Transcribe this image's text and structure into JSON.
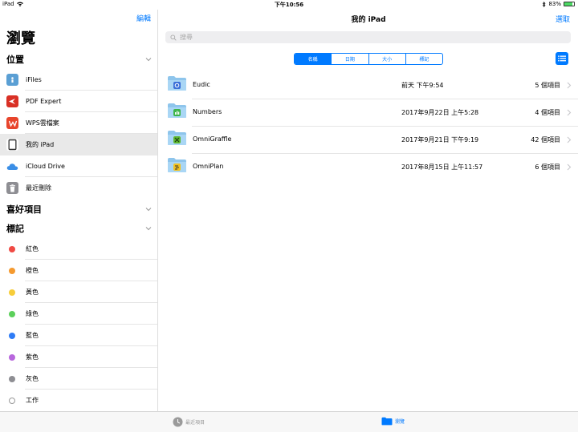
{
  "status": {
    "device": "iPad",
    "time": "下午10:56",
    "battery": "83%",
    "battery_level": 0.83
  },
  "sidebar": {
    "edit_label": "編輯",
    "title": "瀏覽",
    "locations_header": "位置",
    "locations": [
      {
        "label": "iFiles",
        "icon": "ifiles-icon",
        "color": "#5a9fd4"
      },
      {
        "label": "PDF Expert",
        "icon": "pdf-expert-icon",
        "color": "#d93025"
      },
      {
        "label": "WPS雲檔案",
        "icon": "wps-icon",
        "color": "#e8452c"
      },
      {
        "label": "我的 iPad",
        "icon": "ipad-icon",
        "color": "#333333"
      },
      {
        "label": "iCloud Drive",
        "icon": "icloud-icon",
        "color": "#3a8ee6"
      },
      {
        "label": "最近刪除",
        "icon": "trash-icon",
        "color": "#8e8e93"
      }
    ],
    "favorites_header": "喜好項目",
    "tags_header": "標記",
    "tags": [
      {
        "label": "紅色",
        "color": "#f04a44"
      },
      {
        "label": "橙色",
        "color": "#f59a2f"
      },
      {
        "label": "黃色",
        "color": "#f7cd3a"
      },
      {
        "label": "綠色",
        "color": "#5cd05b"
      },
      {
        "label": "藍色",
        "color": "#2f7cf6"
      },
      {
        "label": "紫色",
        "color": "#b867dd"
      },
      {
        "label": "灰色",
        "color": "#8e8e93"
      },
      {
        "label": "工作",
        "color": ""
      }
    ]
  },
  "main": {
    "title": "我的 iPad",
    "select_label": "選取",
    "search_placeholder": "搜尋",
    "sort_tabs": [
      "名稱",
      "日期",
      "大小",
      "標記"
    ],
    "files": [
      {
        "name": "Eudic",
        "date": "前天 下午9:54",
        "count": "5 個項目",
        "badge_color": "#3a6fd8"
      },
      {
        "name": "Numbers",
        "date": "2017年9月22日 上午5:28",
        "count": "4 個項目",
        "badge_color": "#3cb54a"
      },
      {
        "name": "OmniGraffle",
        "date": "2017年9月21日 下午9:19",
        "count": "42 個項目",
        "badge_color": "#5fb830"
      },
      {
        "name": "OmniPlan",
        "date": "2017年8月15日 上午11:57",
        "count": "6 個項目",
        "badge_color": "#f3c21f"
      }
    ]
  },
  "tabbar": {
    "recent_label": "最近項目",
    "browse_label": "瀏覽"
  },
  "colors": {
    "accent": "#007aff"
  }
}
